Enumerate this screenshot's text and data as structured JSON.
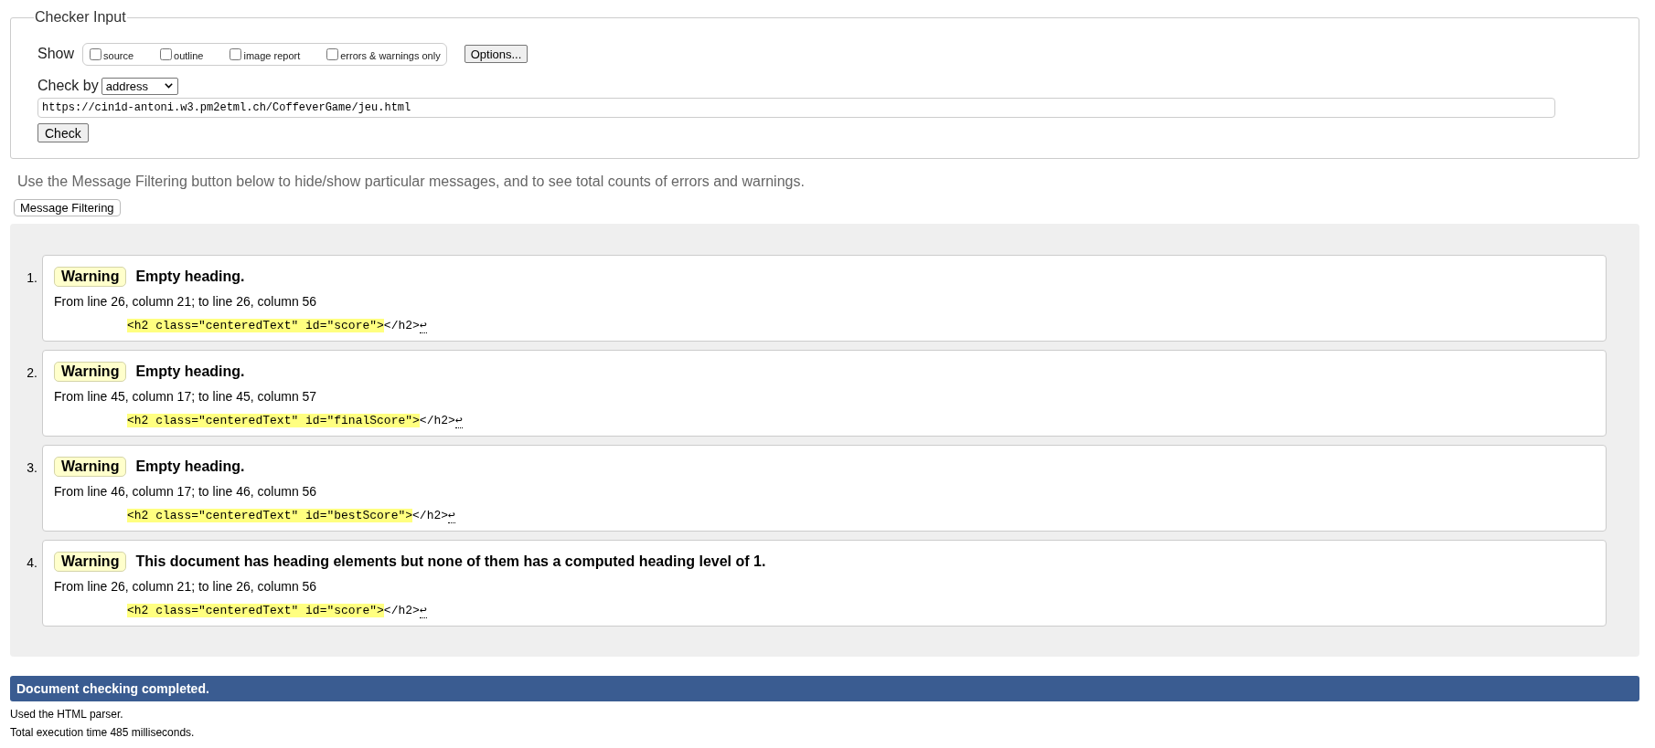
{
  "checker_input": {
    "legend": "Checker Input",
    "show_label": "Show",
    "show_options": [
      {
        "label": "source",
        "checked": false
      },
      {
        "label": "outline",
        "checked": false
      },
      {
        "label": "image report",
        "checked": false
      },
      {
        "label": "errors & warnings only",
        "checked": false
      }
    ],
    "options_button": "Options...",
    "check_by_label": "Check by",
    "check_by": {
      "value": "address"
    },
    "address": {
      "value": "https://cin1d-antoni.w3.pm2etml.ch/CoffeverGame/jeu.html"
    },
    "check_button": "Check"
  },
  "filter_hint": "Use the Message Filtering button below to hide/show particular messages, and to see total counts of errors and warnings.",
  "filter_button": "Message Filtering",
  "messages": [
    {
      "number": "1.",
      "kind": "warning",
      "badge": "Warning",
      "title": "Empty heading.",
      "location": "From line 26, column 21; to line 26, column 56",
      "extract": {
        "highlighted": "<h2 class=\"centeredText\" id=\"score\">",
        "rest": "</h2>",
        "end_marker": "↩"
      }
    },
    {
      "number": "2.",
      "kind": "warning",
      "badge": "Warning",
      "title": "Empty heading.",
      "location": "From line 45, column 17; to line 45, column 57",
      "extract": {
        "highlighted": "<h2 class=\"centeredText\" id=\"finalScore\">",
        "rest": "</h2>",
        "end_marker": "↩"
      }
    },
    {
      "number": "3.",
      "kind": "warning",
      "badge": "Warning",
      "title": "Empty heading.",
      "location": "From line 46, column 17; to line 46, column 56",
      "extract": {
        "highlighted": "<h2 class=\"centeredText\" id=\"bestScore\">",
        "rest": "</h2>",
        "end_marker": "↩"
      }
    },
    {
      "number": "4.",
      "kind": "warning",
      "badge": "Warning",
      "title": "This document has heading elements but none of them has a computed heading level of 1.",
      "location": "From line 26, column 21; to line 26, column 56",
      "extract": {
        "highlighted": "<h2 class=\"centeredText\" id=\"score\">",
        "rest": "</h2>",
        "end_marker": "↩"
      }
    }
  ],
  "status_bar": "Document checking completed.",
  "footer": [
    "Used the HTML parser.",
    "Total execution time 485 milliseconds."
  ]
}
